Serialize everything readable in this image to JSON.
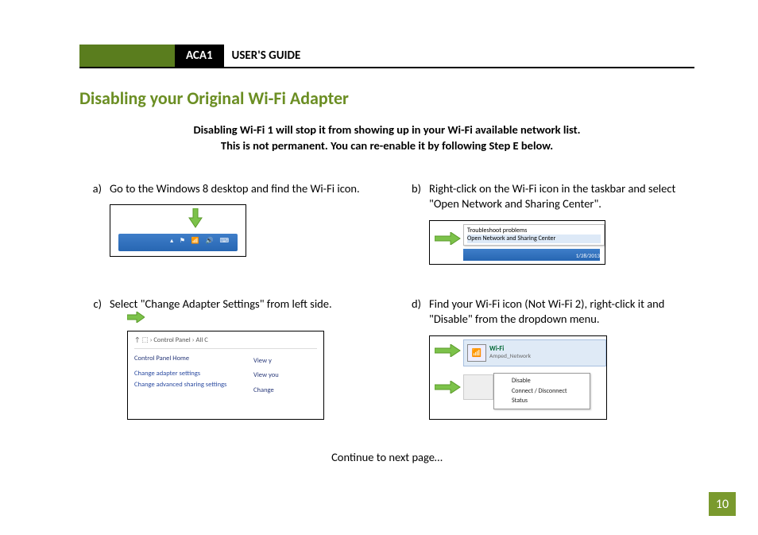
{
  "header": {
    "product": "ACA1",
    "title": "USER'S GUIDE"
  },
  "section_title": "Disabling your Original Wi-Fi Adapter",
  "intro_line1": "Disabling Wi-Fi 1 will stop it from showing up in your Wi-Fi available network list.",
  "intro_line2": "This is not permanent. You can re-enable it by following Step E below.",
  "steps": {
    "a": {
      "label": "a)",
      "text": "Go to the Windows 8 desktop and find the Wi-Fi icon."
    },
    "b": {
      "label": "b)",
      "text": "Right-click on the Wi-Fi icon in the taskbar and select \"Open Network and Sharing Center\"."
    },
    "c": {
      "label": "c)",
      "text": "Select \"Change Adapter Settings\" from left side."
    },
    "d": {
      "label": "d)",
      "text": "Find your Wi-Fi icon (Not Wi-Fi 2), right-click it and \"Disable\" from the dropdown menu."
    }
  },
  "fig_b": {
    "menu_item1": "Troubleshoot problems",
    "menu_item2": "Open Network and Sharing Center",
    "date": "1/28/2013"
  },
  "fig_c": {
    "breadcrumb": "↑  ⬚  ›  Control Panel  ›  All C",
    "home": "Control Panel Home",
    "link1": "Change adapter settings",
    "link2": "Change advanced sharing settings",
    "right1": "View y",
    "right2": "View you",
    "right3": "Change"
  },
  "fig_d": {
    "adapter_name": "Wi-Fi",
    "adapter_sub": "Amped_Network",
    "menu1": "Disable",
    "menu2": "Connect / Disconnect",
    "menu3": "Status"
  },
  "continue_text": "Continue to next page…",
  "page_number": "10"
}
